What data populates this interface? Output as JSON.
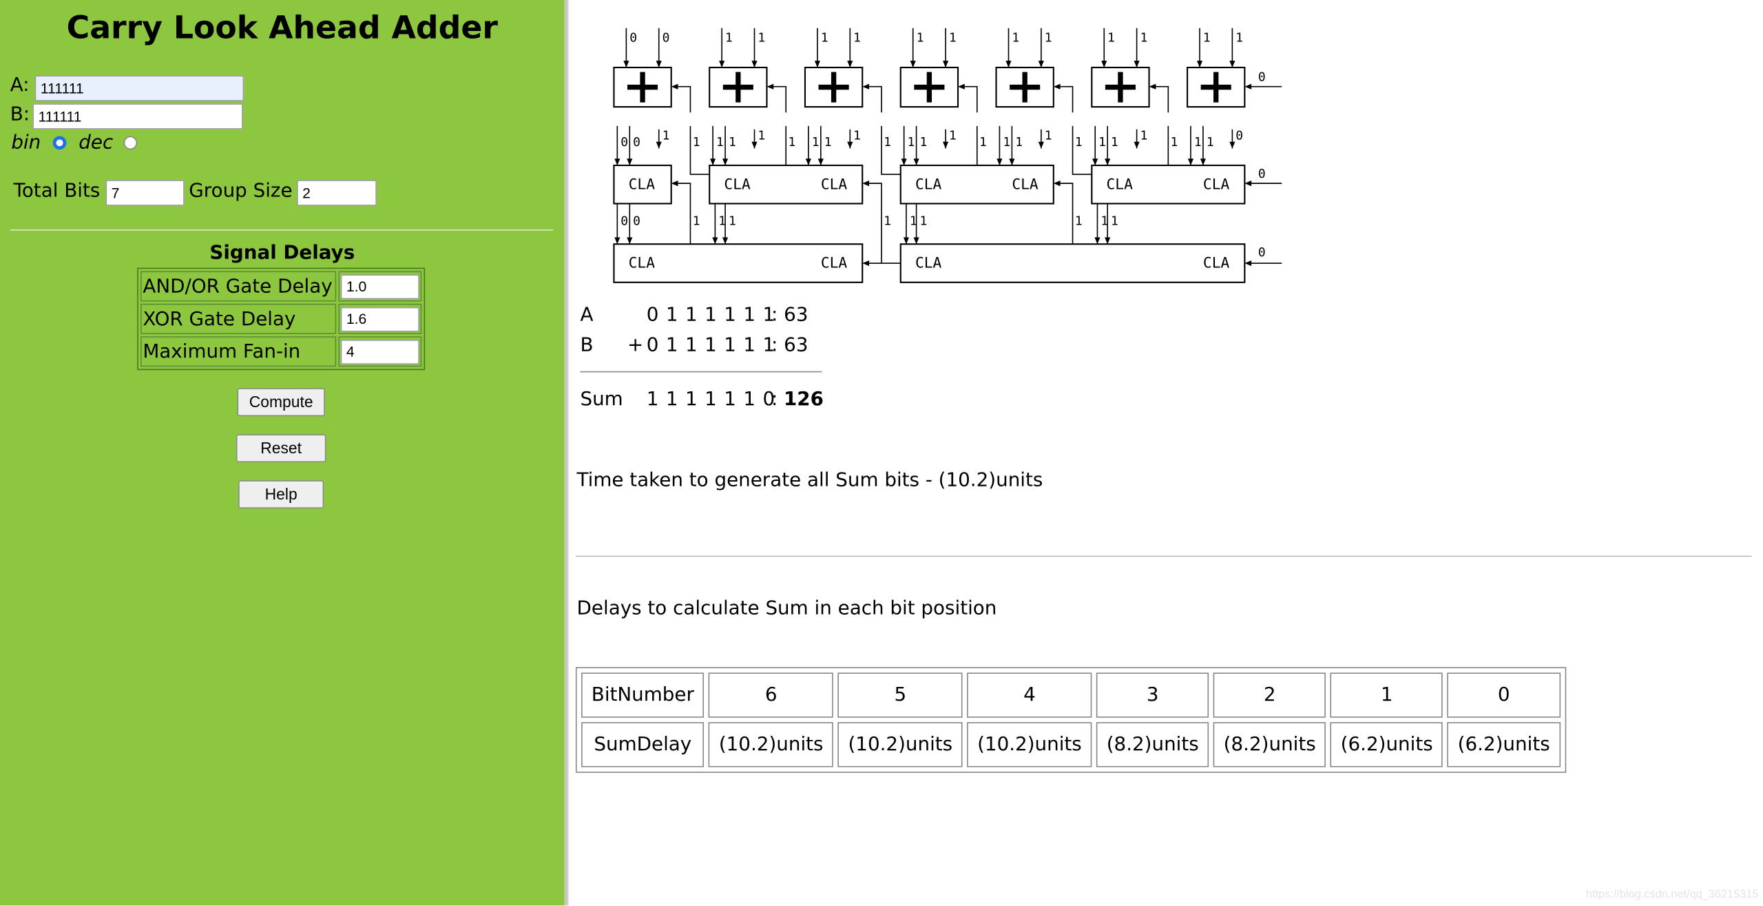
{
  "sidebar": {
    "title": "Carry Look Ahead Adder",
    "a_label": "A:",
    "a_value": "111111",
    "b_label": "B:",
    "b_value": "111111",
    "bin_label": "bin",
    "dec_label": "dec",
    "mode_selected": "bin",
    "total_bits_label": "Total Bits",
    "total_bits_value": "7",
    "group_size_label": "Group Size",
    "group_size_value": "2",
    "signal_delays_heading": "Signal Delays",
    "delays": [
      {
        "label": "AND/OR Gate Delay",
        "value": "1.0"
      },
      {
        "label": "XOR Gate Delay",
        "value": "1.6"
      },
      {
        "label": "Maximum Fan-in",
        "value": "4"
      }
    ],
    "compute_label": "Compute",
    "reset_label": "Reset",
    "help_label": "Help"
  },
  "diagram": {
    "adder_inputs": [
      [
        "0",
        "0"
      ],
      [
        "1",
        "1"
      ],
      [
        "1",
        "1"
      ],
      [
        "1",
        "1"
      ],
      [
        "1",
        "1"
      ],
      [
        "1",
        "1"
      ],
      [
        "1",
        "1"
      ]
    ],
    "adder_carry_in": "0",
    "block_label": "CLA",
    "level1_inputs": [
      [
        "0",
        "0"
      ],
      [
        "1",
        "1"
      ],
      [
        "1",
        "1"
      ],
      [
        "1",
        "1"
      ],
      [
        "1",
        "1"
      ],
      [
        "1",
        "1"
      ],
      [
        "1",
        "1"
      ]
    ],
    "level1_carries": [
      "1",
      "1",
      "1",
      "1",
      "1",
      "1",
      "0"
    ],
    "level1_side_labels": [
      "1",
      "1",
      "1",
      "1",
      "1",
      "1"
    ],
    "level1_carry_in": "0",
    "level1_between_labels": [
      "1",
      "1",
      "1"
    ],
    "level2_inputs": [
      [
        "0",
        "0"
      ],
      [
        "1",
        "1"
      ],
      [
        "1",
        "1"
      ],
      [
        "1",
        "1"
      ]
    ],
    "level2_carry_in": "0"
  },
  "result": {
    "a_label": "A",
    "a_bits": "0 1 1 1 1 1 1",
    "a_dec": ": 63",
    "b_label": "B",
    "b_op": "+",
    "b_bits": "0 1 1 1 1 1 1",
    "b_dec": ": 63",
    "sum_label": "Sum",
    "sum_bits": "1 1 1 1 1 1 0",
    "sum_sep": ":",
    "sum_dec": "126",
    "time_text": "Time taken to generate all Sum bits - (10.2)units",
    "delays_heading": "Delays to calculate Sum in each bit position"
  },
  "delay_table": {
    "row_headers": [
      "BitNumber",
      "SumDelay"
    ],
    "bit_numbers": [
      "6",
      "5",
      "4",
      "3",
      "2",
      "1",
      "0"
    ],
    "sum_delays": [
      "(10.2)units",
      "(10.2)units",
      "(10.2)units",
      "(8.2)units",
      "(8.2)units",
      "(6.2)units",
      "(6.2)units"
    ]
  },
  "watermark": "https://blog.csdn.net/qq_36215315",
  "colors": {
    "sidebar_bg": "#8dc63f",
    "radio_selected": "#1a73e8"
  }
}
